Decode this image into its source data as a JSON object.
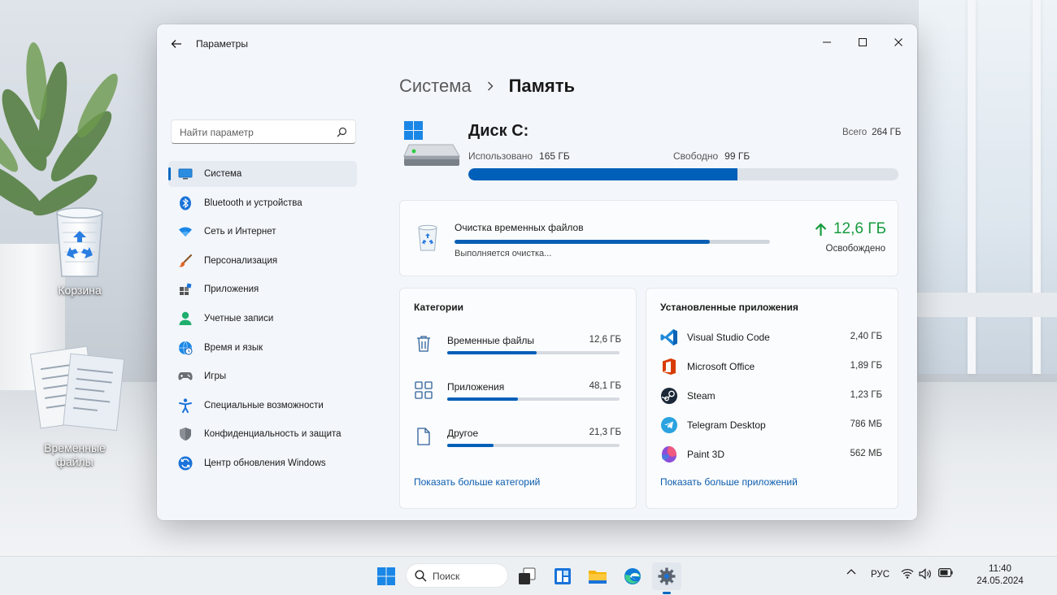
{
  "desktop": {
    "icons": [
      {
        "label": "Корзина"
      },
      {
        "label_line1": "Временные",
        "label_line2": "файлы"
      }
    ]
  },
  "window": {
    "title": "Параметры",
    "breadcrumb": {
      "parent": "Система",
      "current": "Память"
    },
    "search": {
      "placeholder": "Найти параметр"
    },
    "nav": [
      {
        "label": "Система",
        "icon": "monitor-icon",
        "active": true
      },
      {
        "label": "Bluetooth и устройства",
        "icon": "bluetooth-icon"
      },
      {
        "label": "Сеть и Интернет",
        "icon": "wifi-icon"
      },
      {
        "label": "Персонализация",
        "icon": "brush-icon"
      },
      {
        "label": "Приложения",
        "icon": "apps-icon"
      },
      {
        "label": "Учетные записи",
        "icon": "user-icon"
      },
      {
        "label": "Время и язык",
        "icon": "globe-clock-icon"
      },
      {
        "label": "Игры",
        "icon": "gamepad-icon"
      },
      {
        "label": "Специальные возможности",
        "icon": "accessibility-icon"
      },
      {
        "label": "Конфиденциальность и защита",
        "icon": "shield-icon"
      },
      {
        "label": "Центр обновления Windows",
        "icon": "update-icon"
      }
    ],
    "disk": {
      "name": "Диск C:",
      "total_label": "Всего",
      "total": "264 ГБ",
      "used_label": "Использовано",
      "used": "165 ГБ",
      "free_label": "Свободно",
      "free": "99 ГБ",
      "used_fraction": 0.625
    },
    "cleanup": {
      "title": "Очистка временных файлов",
      "status": "Выполняется очистка...",
      "progress_fraction": 0.81,
      "freed_amount": "12,6 ГБ",
      "freed_label": "Освобождено"
    },
    "categories": {
      "heading": "Категории",
      "items": [
        {
          "label": "Временные файлы",
          "value": "12,6 ГБ",
          "fraction": 0.52,
          "icon": "trash-icon"
        },
        {
          "label": "Приложения",
          "value": "48,1 ГБ",
          "fraction": 0.41,
          "icon": "apps-grid-icon"
        },
        {
          "label": "Другое",
          "value": "21,3 ГБ",
          "fraction": 0.27,
          "icon": "document-icon"
        }
      ],
      "more_link": "Показать больше категорий"
    },
    "installed_apps": {
      "heading": "Установленные приложения",
      "items": [
        {
          "label": "Visual Studio Code",
          "value": "2,40 ГБ",
          "icon": "vscode-icon"
        },
        {
          "label": "Microsoft Office",
          "value": "1,89 ГБ",
          "icon": "office-icon"
        },
        {
          "label": "Steam",
          "value": "1,23 ГБ",
          "icon": "steam-icon"
        },
        {
          "label": "Telegram Desktop",
          "value": "786 МБ",
          "icon": "telegram-icon"
        },
        {
          "label": "Paint 3D",
          "value": "562 МБ",
          "icon": "paint3d-icon"
        }
      ],
      "more_link": "Показать больше приложений"
    }
  },
  "taskbar": {
    "search_placeholder": "Поиск",
    "language": "РУС",
    "time": "11:40",
    "date": "24.05.2024"
  },
  "colors": {
    "accent": "#005fb8",
    "freed_green": "#169b3e",
    "link": "#0b5cad"
  }
}
